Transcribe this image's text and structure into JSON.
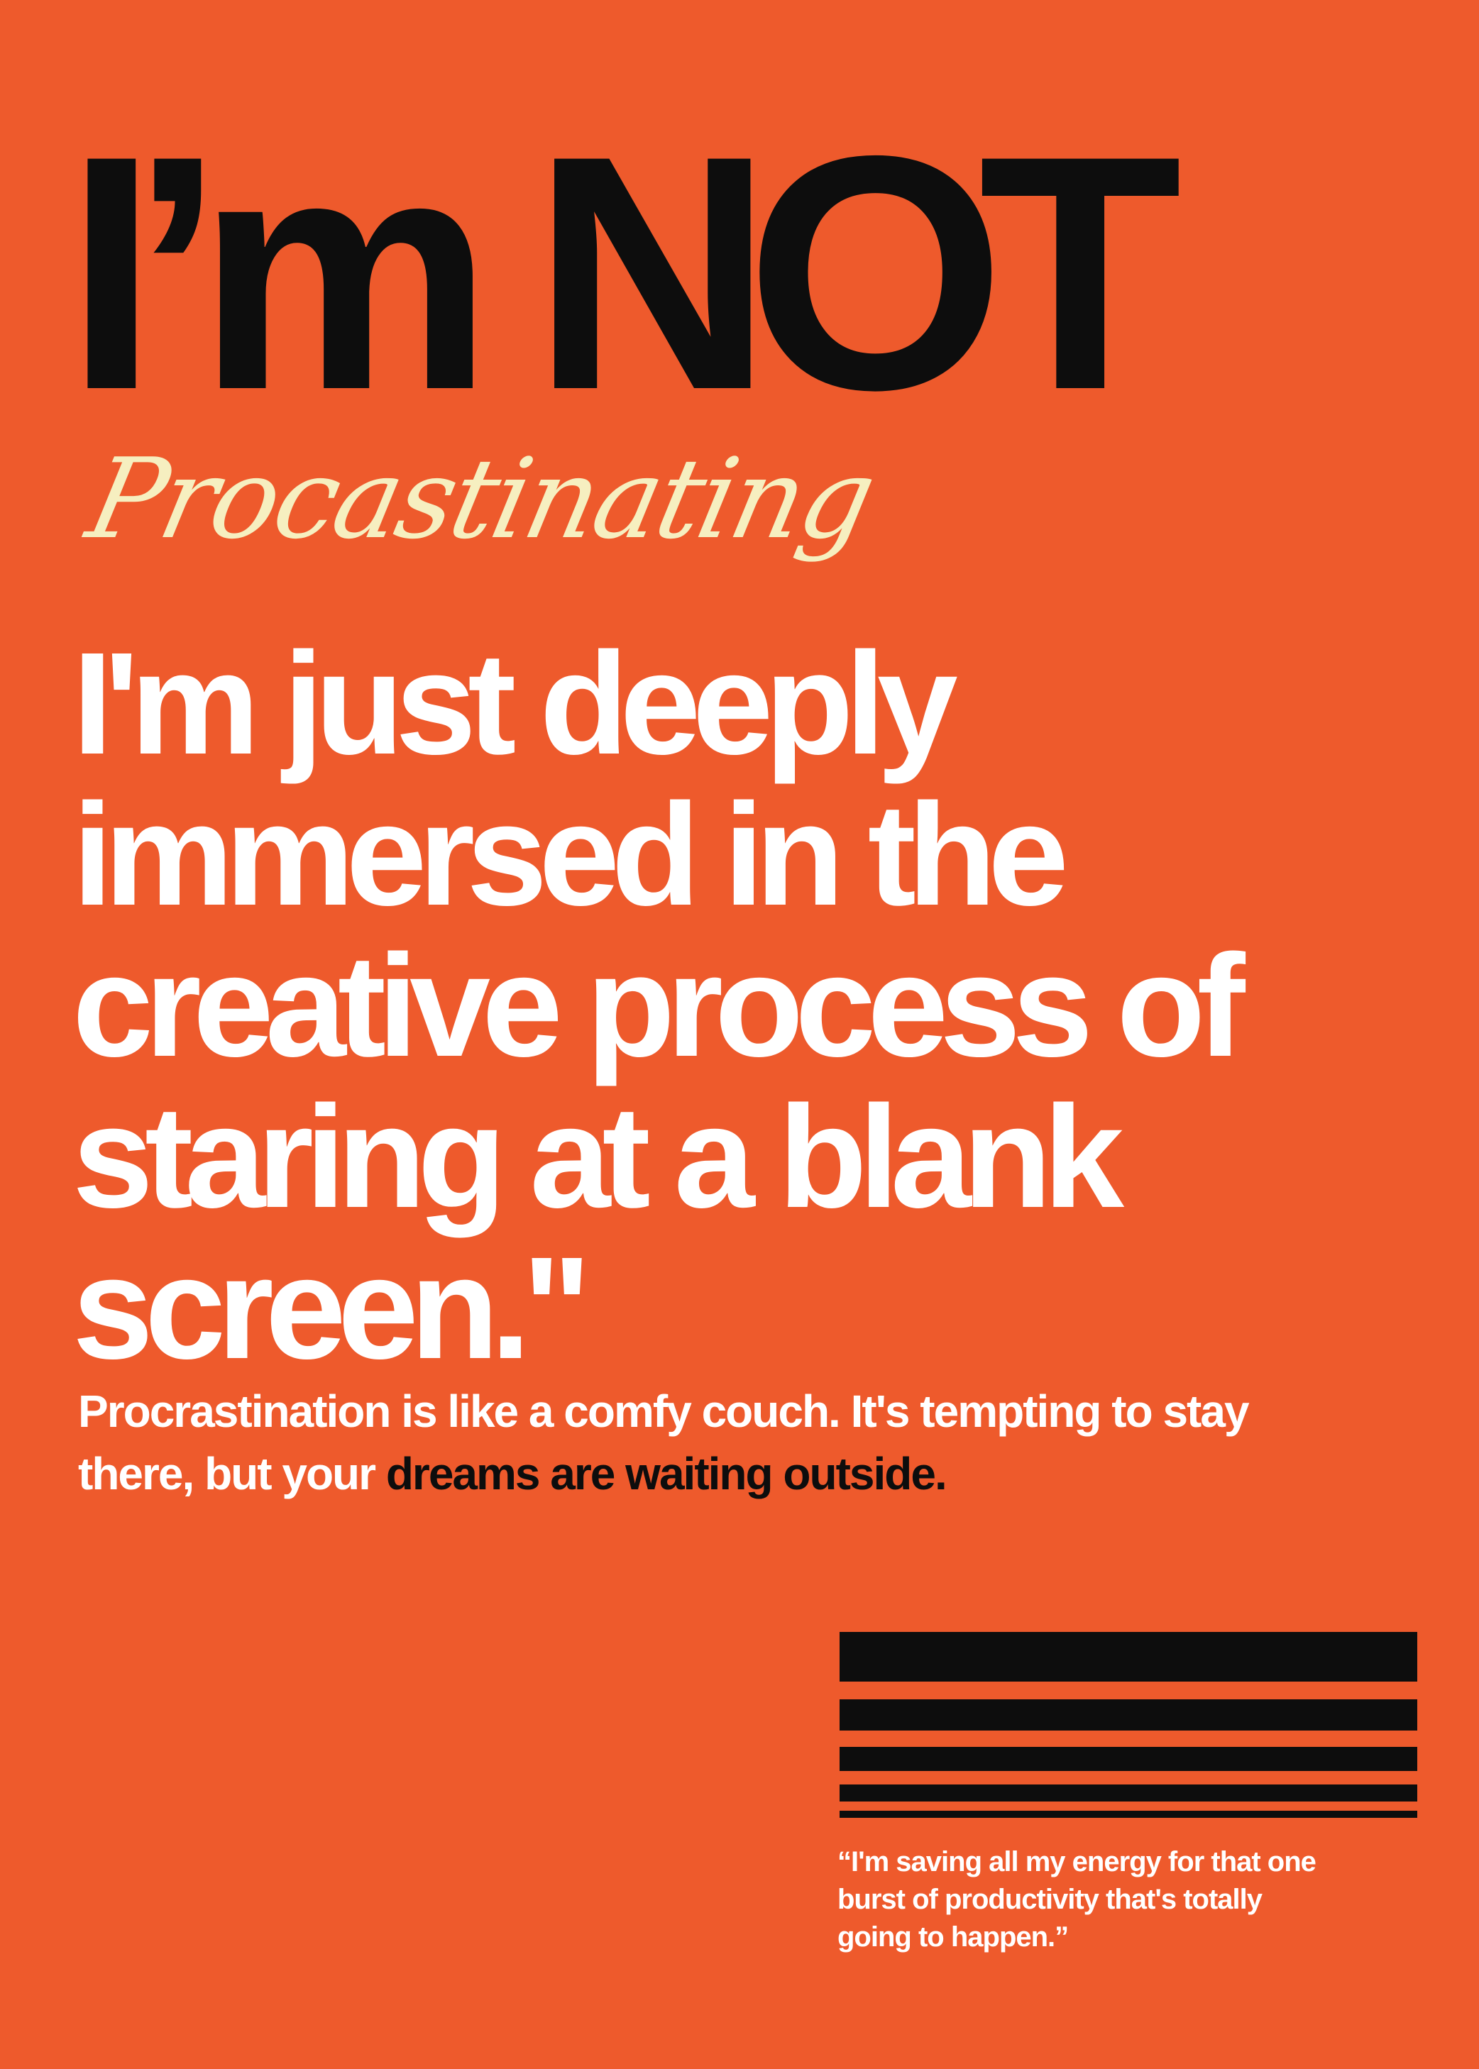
{
  "colors": {
    "background": "#ee5a2c",
    "headline": "#0d0d0d",
    "script": "#f6efc0",
    "text": "#ffffff",
    "emphasis": "#0d0d0d"
  },
  "poster": {
    "headline": "I’m NOT",
    "script_word": "Procastinating",
    "statement_lines": [
      "I'm just deeply",
      "immersed in the",
      "creative process of",
      "staring at a blank",
      "screen.\""
    ],
    "body": {
      "line1": "Procrastination is like a comfy couch. It's tempting to stay",
      "line2_plain": "there, but your ",
      "line2_emphasis": "dreams are waiting outside."
    },
    "quote_lines": [
      "“I'm saving all my energy for that one",
      "burst of productivity that's totally",
      "going to happen.”"
    ]
  }
}
